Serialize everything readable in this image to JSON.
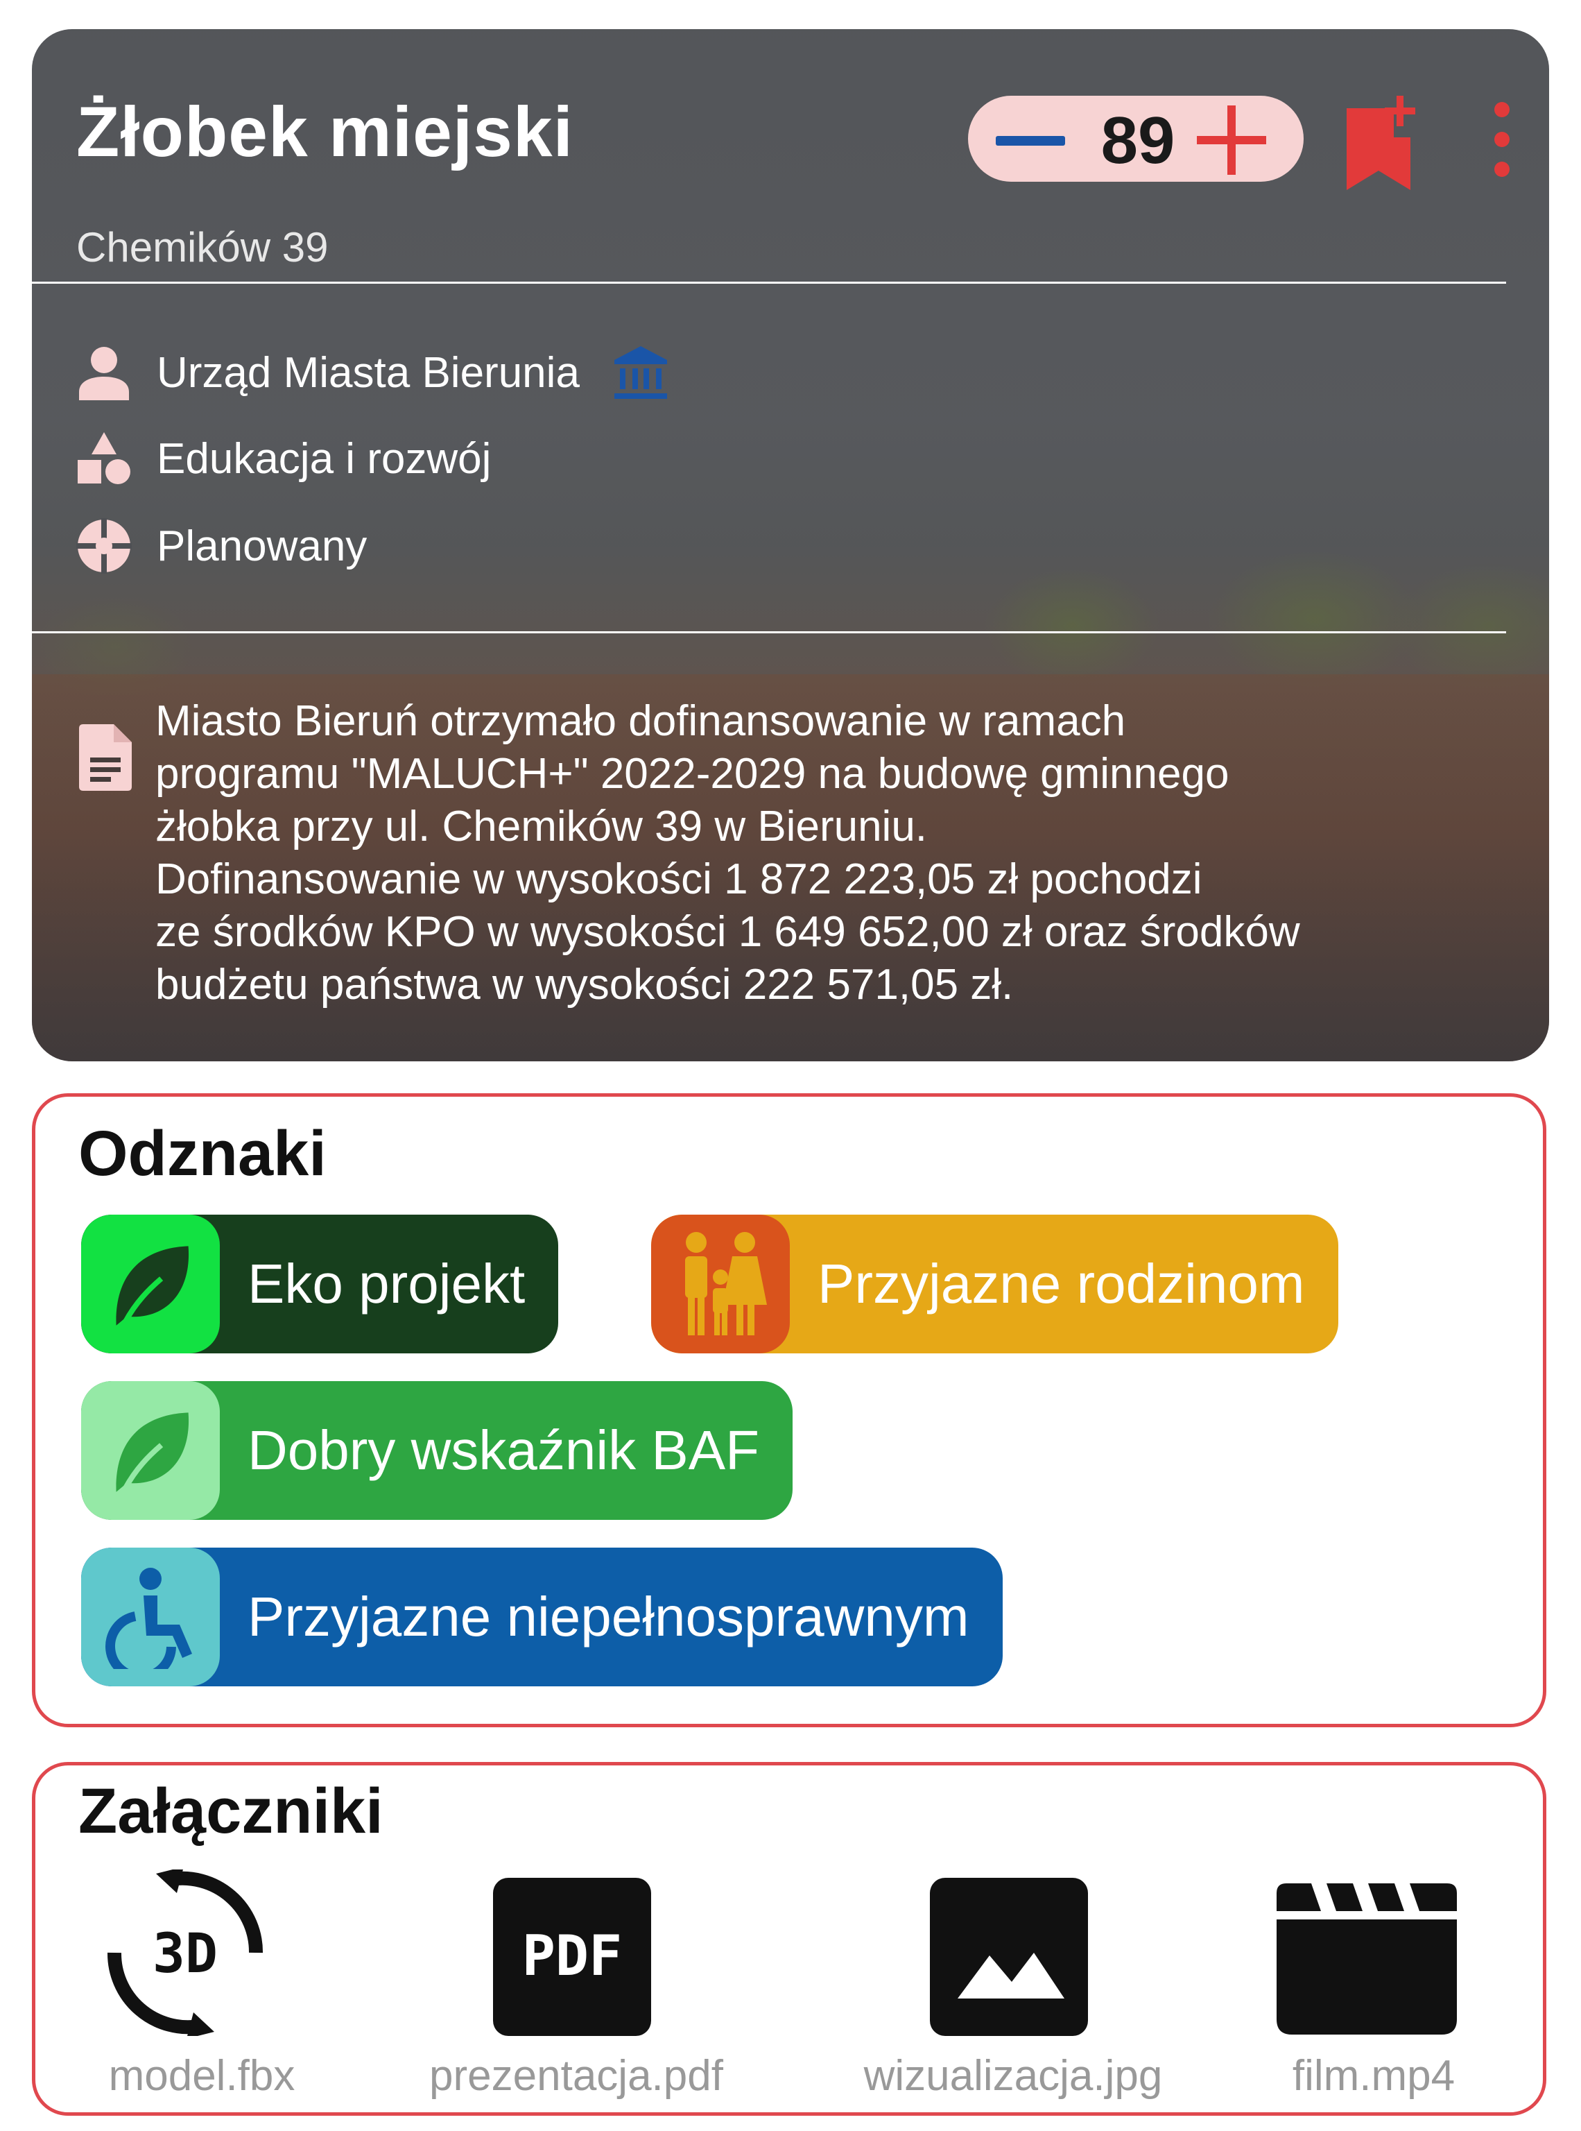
{
  "header": {
    "title": "Żłobek miejski",
    "address": "Chemików 39",
    "vote_count": "89",
    "icons": [
      "minus-icon",
      "plus-icon",
      "bookmark-add-icon",
      "more-vertical-icon"
    ]
  },
  "meta": {
    "owner": "Urząd Miasta Bierunia",
    "category": "Edukacja i rozwój",
    "status": "Planowany"
  },
  "description": "Miasto Bieruń otrzymało dofinansowanie w ramach\nprogramu \"MALUCH+\" 2022-2029 na budowę gminnego\nżłobka przy ul. Chemików 39 w Bieruniu.\nDofinansowanie w wysokości 1 872 223,05 zł pochodzi\nze środków KPO w wysokości 1 649 652,00 zł oraz środków\nbudżetu państwa w wysokości 222 571,05 zł.",
  "badges": {
    "title": "Odznaki",
    "items": [
      {
        "label": "Eko projekt",
        "icon": "leaf-icon",
        "color": "#173f1d",
        "icon_bg": "#12e142"
      },
      {
        "label": "Przyjazne rodzinom",
        "icon": "family-icon",
        "color": "#e6a817",
        "icon_bg": "#d9531c"
      },
      {
        "label": "Dobry wskaźnik BAF",
        "icon": "leaf-icon",
        "color": "#2ea642",
        "icon_bg": "#95e9a6"
      },
      {
        "label": "Przyjazne niepełnosprawnym",
        "icon": "wheelchair-icon",
        "color": "#0d5ea8",
        "icon_bg": "#5fc8cc"
      }
    ]
  },
  "attachments": {
    "title": "Załączniki",
    "items": [
      {
        "name": "model.fbx",
        "icon": "3d-rotation-icon",
        "glyph": "3D"
      },
      {
        "name": "prezentacja.pdf",
        "icon": "pdf-icon",
        "glyph": "PDF"
      },
      {
        "name": "wizualizacja.jpg",
        "icon": "image-icon"
      },
      {
        "name": "film.mp4",
        "icon": "movie-clapper-icon"
      }
    ]
  },
  "colors": {
    "accent_red": "#e0484e",
    "icon_pink": "#f7d3d3",
    "blue": "#1a55a8"
  }
}
